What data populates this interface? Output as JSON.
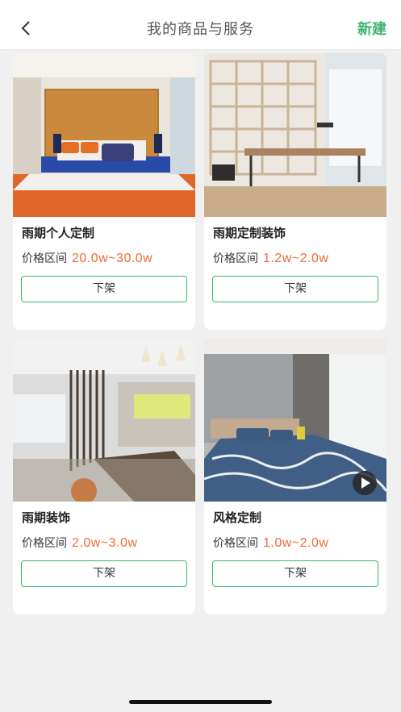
{
  "nav": {
    "back_icon": "chevron-left-icon",
    "title": "我的商品与服务",
    "new_label": "新建",
    "accent": "#3cb371"
  },
  "price_prefix": "价格区间",
  "price_color": "#f06a3c",
  "items": [
    {
      "name": "雨期个人定制",
      "price": "20.0w~30.0w",
      "button": "下架",
      "image": "orange-bedroom"
    },
    {
      "name": "雨期定制装饰",
      "price": "1.2w~2.0w",
      "button": "下架",
      "image": "study-shelves"
    },
    {
      "name": "雨期装饰",
      "price": "2.0w~3.0w",
      "button": "下架",
      "image": "dining-living-room"
    },
    {
      "name": "风格定制",
      "price": "1.0w~2.0w",
      "button": "下架",
      "image": "blue-bedroom",
      "play_icon": "play-icon"
    }
  ]
}
